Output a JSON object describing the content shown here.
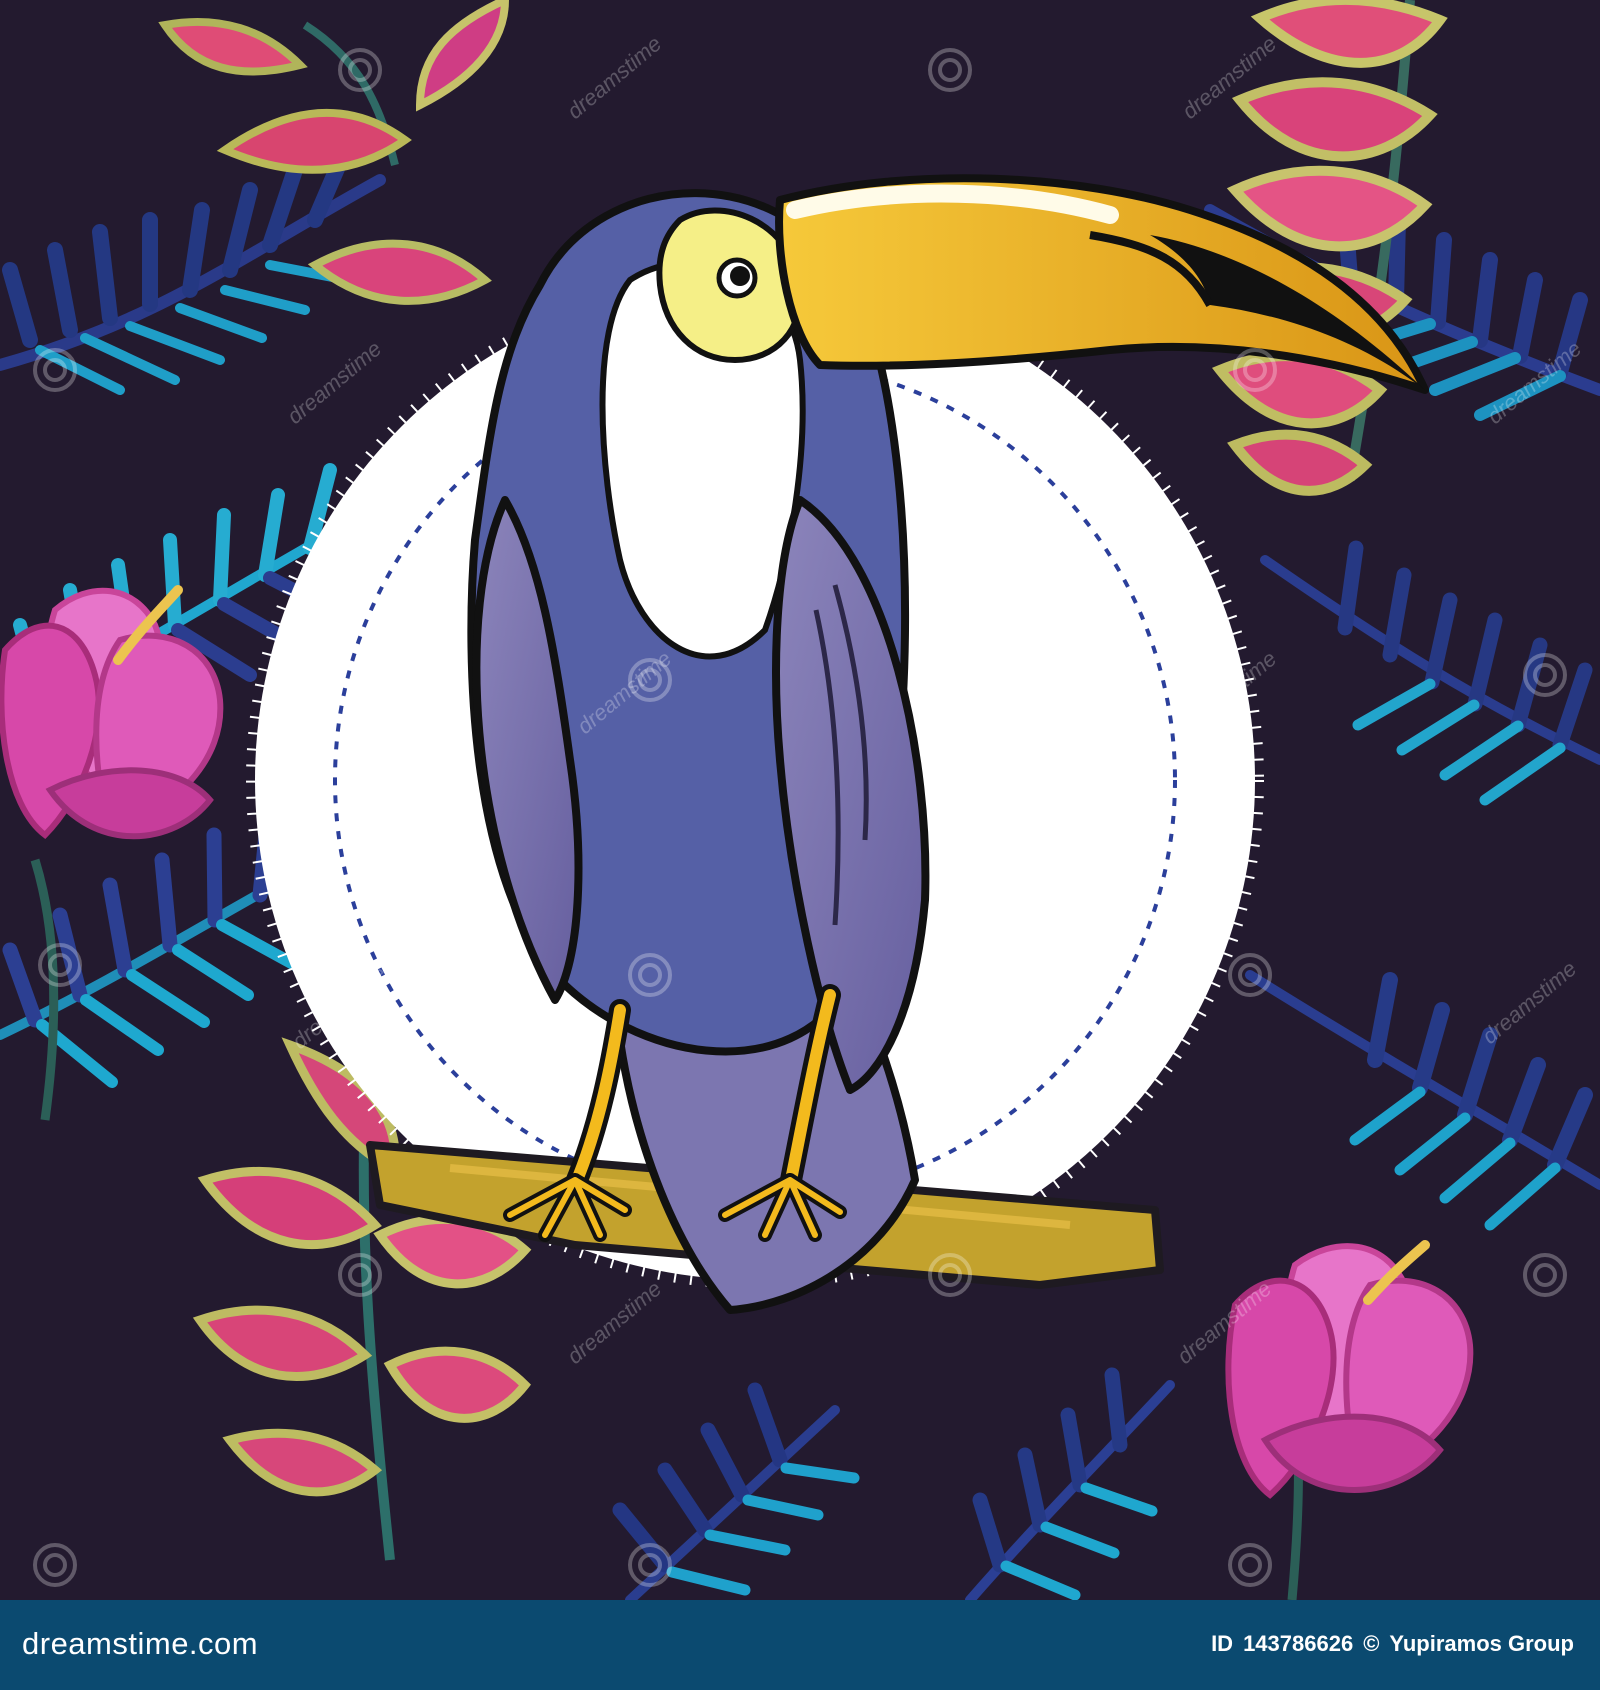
{
  "illustration": {
    "subject": "toucan-on-branch",
    "colors": {
      "background": "#231a2f",
      "leaf_dark": "#263c8c",
      "leaf_teal": "#25a5c8",
      "flower_pink": "#d33aa5",
      "flower_light": "#f08fd2",
      "badge_white": "#ffffff",
      "badge_zigzag": "#2b3f9b",
      "toucan_body": "#5460a6",
      "toucan_wing": "#7a74ad",
      "beak_yellow": "#f2bd25",
      "branch": "#c3a22d"
    }
  },
  "watermark": {
    "text": "dreamstime"
  },
  "footer": {
    "logo_text": "dreamstime.com",
    "id_label": "ID",
    "id_value": "143786626",
    "copyright_symbol": "©",
    "author": "Yupiramos Group",
    "background_color": "#0b4a70"
  }
}
